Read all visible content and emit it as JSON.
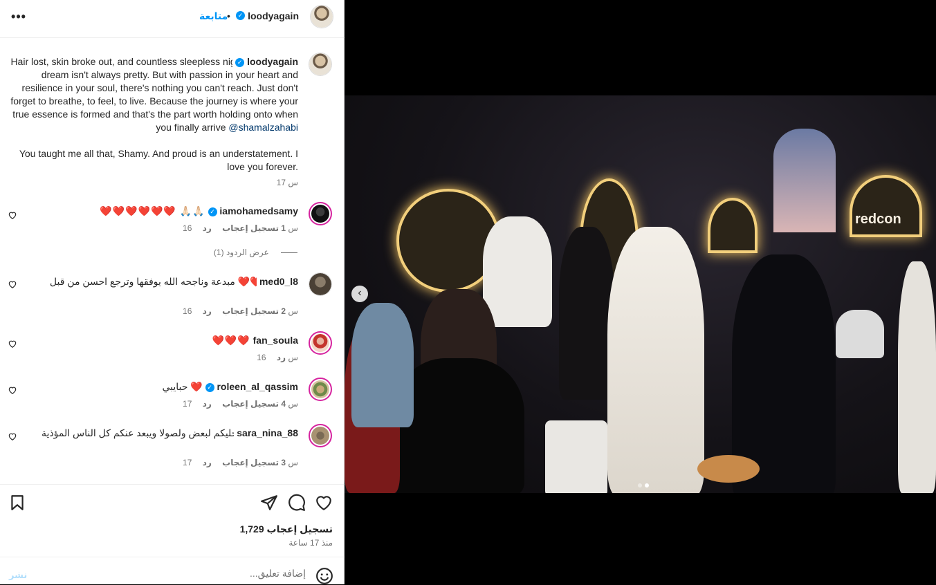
{
  "header": {
    "username": "loodyagain",
    "separator": "•",
    "follow_label": "متابعة",
    "more_label": "•••"
  },
  "caption": {
    "username": "loodyagain",
    "text_before_mention": "Hair lost, skin broke out, and countless sleepless nights.. chasing a dream isn't always pretty. But with passion in your heart and resilience in your soul, there's nothing you can't reach. Just don't forget to breathe, to feel, to live. Because the journey is where your true essence is formed and that's the part worth holding onto when you finally arrive ",
    "mention": "@shamalzahabi",
    "text_after": "You taught me all that, Shamy. And proud is an understatement. I love you forever.",
    "time": "17 س"
  },
  "comments": [
    {
      "username": "iamohamedsamy",
      "verified": true,
      "text": "❤️❤️❤️❤️❤️❤️ 🙏🏻🙏🏻",
      "time": "16 س",
      "likes": "1 تسجيل إعجاب",
      "reply": "رد"
    },
    {
      "username": "med0_l8",
      "verified": false,
      "text": "مبدعة وناجحه الله يوفقها وترجع احسن من قبل ❤️❤️❤️❤️❤️",
      "time": "16 س",
      "likes": "2 تسجيل إعجاب",
      "reply": "رد"
    },
    {
      "username": "fan_soula",
      "verified": false,
      "text": "❤️❤️❤️",
      "time": "16 س",
      "likes": "",
      "reply": "رد"
    },
    {
      "username": "roleen_al_qassim",
      "verified": true,
      "text": "حبايبي ❤️",
      "time": "17 س",
      "likes": "4 تسجيل إعجاب",
      "reply": "رد"
    },
    {
      "username": "sara_nina_88",
      "verified": false,
      "text": "الله يحفظكم ويخليكم لبعض ولصولا ويبعد عنكم كل الناس المؤذية",
      "time": "17 س",
      "likes": "3 تسجيل إعجاب",
      "reply": "رد"
    }
  ],
  "view_replies": "عرض الردود (1)",
  "footer": {
    "likes": "1,729 تسجيل إعجاب",
    "ago": "منذ 17 ساعة"
  },
  "composer": {
    "placeholder": "إضافة تعليق...",
    "post_label": "نشر"
  },
  "media": {
    "sign_text": "redcon",
    "carousel_prev": "‹"
  },
  "colors": {
    "accent": "#0095f6",
    "heart": "#e0245e"
  }
}
